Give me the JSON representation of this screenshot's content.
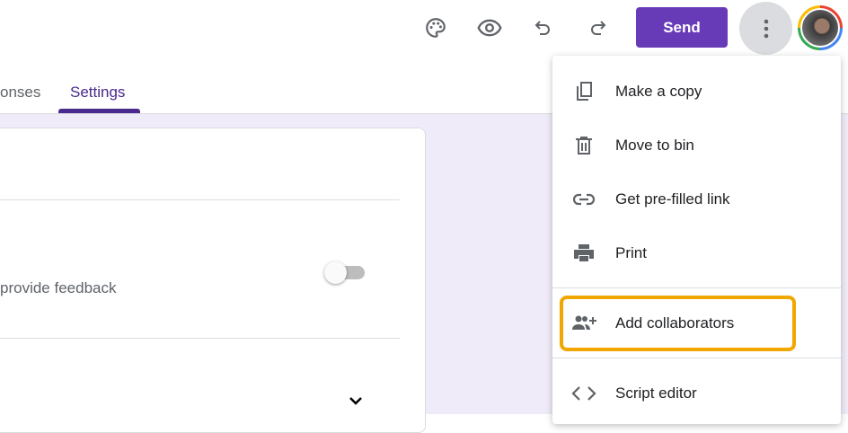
{
  "toolbar": {
    "send_label": "Send",
    "icons": [
      "palette-icon",
      "eye-icon",
      "undo-icon",
      "redo-icon",
      "more-vert-icon"
    ]
  },
  "tabs": [
    {
      "label": "onses"
    },
    {
      "label": "Settings",
      "active": true
    }
  ],
  "settings": {
    "feedback_text": "provide feedback",
    "toggle_on": false
  },
  "menu": {
    "items": [
      {
        "label": "Make a copy",
        "icon": "copy-icon"
      },
      {
        "label": "Move to bin",
        "icon": "trash-icon"
      },
      {
        "label": "Get pre-filled link",
        "icon": "link-icon"
      },
      {
        "label": "Print",
        "icon": "print-icon"
      },
      {
        "label": "Add collaborators",
        "icon": "add-people-icon",
        "highlighted": true
      },
      {
        "label": "Script editor",
        "icon": "code-icon"
      }
    ]
  },
  "colors": {
    "accent": "#673ab7",
    "highlight": "#f2a600",
    "background": "#f0ebf8"
  }
}
